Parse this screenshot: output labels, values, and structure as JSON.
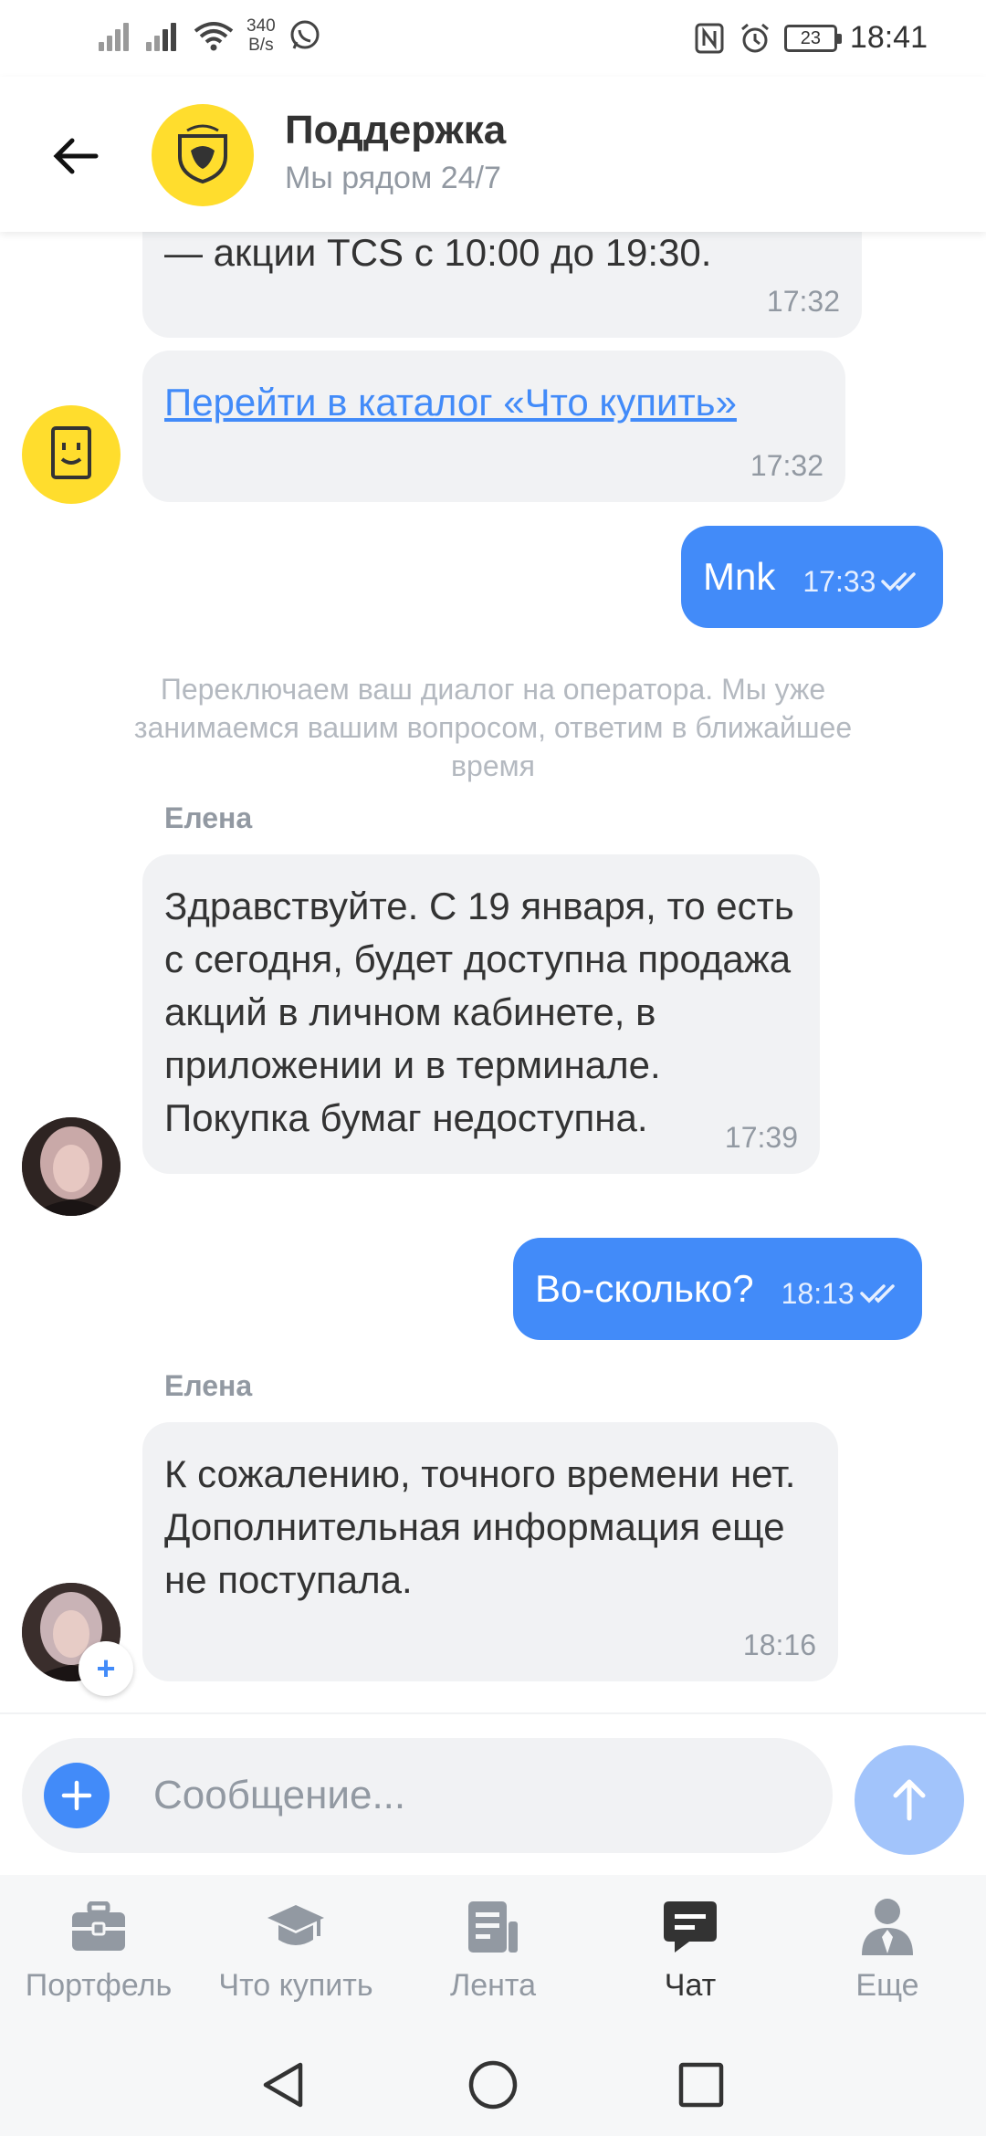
{
  "status_bar": {
    "net_speed_value": "340",
    "net_speed_unit": "B/s",
    "battery": "23",
    "time": "18:41"
  },
  "header": {
    "title": "Поддержка",
    "subtitle": "Мы рядом 24/7"
  },
  "messages": {
    "m1": {
      "text": "— акции TCS с 10:00 до 19:30.",
      "time": "17:32"
    },
    "m2": {
      "link": "Перейти в каталог «Что купить»",
      "time": "17:32"
    },
    "m3": {
      "text": "Mnk",
      "time": "17:33"
    },
    "system": "Переключаем ваш диалог на оператора. Мы уже занимаемся вашим вопросом, ответим в ближайшее время",
    "sender1": "Елена",
    "m4": {
      "text": "Здравствуйте. С 19 января, то есть с сегодня, будет доступна продажа акций в личном кабинете, в приложении и в терминале. Покупка бумаг недоступна.",
      "time": "17:39"
    },
    "m5": {
      "text": "Во-сколько?",
      "time": "18:13"
    },
    "sender2": "Елена",
    "m6": {
      "text": "К сожалению, точного времени нет. Дополнительная информация еще не поступала.",
      "time": "18:16"
    }
  },
  "composer": {
    "placeholder": "Сообщение..."
  },
  "bottom_nav": {
    "items": [
      {
        "label": "Портфель",
        "icon": "briefcase-icon"
      },
      {
        "label": "Что купить",
        "icon": "graduation-cap-icon"
      },
      {
        "label": "Лента",
        "icon": "news-feed-icon"
      },
      {
        "label": "Чат",
        "icon": "chat-icon",
        "active": true
      },
      {
        "label": "Еще",
        "icon": "profile-icon"
      }
    ]
  },
  "colors": {
    "accent": "#428bf9",
    "brand_yellow": "#ffdd2d",
    "bubble_in": "#f1f2f4",
    "muted_text": "#9299a2"
  }
}
